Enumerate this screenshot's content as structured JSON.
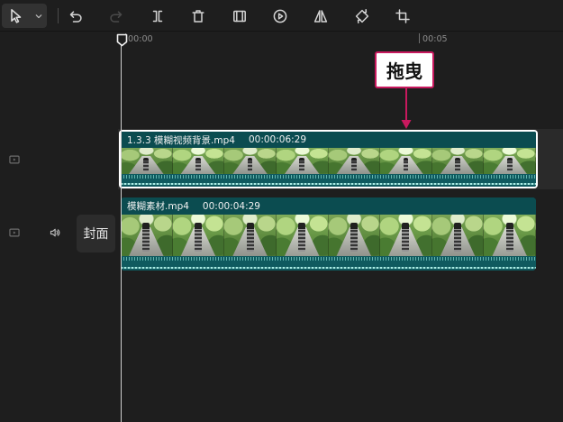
{
  "colors": {
    "background": "#1e1e1e",
    "clip": "#0f5a5f",
    "clip_header": "#0b4c50",
    "selection_border": "#ffffff",
    "annotation_accent": "#c8195e",
    "playhead": "#cfcfcf",
    "selected_track_row": "#2a2a2a"
  },
  "toolbar": {
    "select_tool": {
      "icon": "cursor-select-icon",
      "dropdown_icon": "chevron-down-icon",
      "active": true
    },
    "tools": [
      {
        "icon": "undo-icon",
        "enabled": true
      },
      {
        "icon": "redo-icon",
        "enabled": false
      },
      {
        "icon": "split-icon",
        "enabled": true
      },
      {
        "icon": "delete-icon",
        "enabled": true
      },
      {
        "icon": "freeze-frame-icon",
        "enabled": true
      },
      {
        "icon": "reverse-icon",
        "enabled": true
      },
      {
        "icon": "mirror-icon",
        "enabled": true
      },
      {
        "icon": "rotate-icon",
        "enabled": true
      },
      {
        "icon": "crop-icon",
        "enabled": true
      }
    ]
  },
  "ruler": {
    "timecodes": [
      "00:00",
      "00:05"
    ]
  },
  "annotation": {
    "label": "拖曳"
  },
  "tracks": {
    "overlay": {
      "header_icons": [
        "video-track-icon"
      ],
      "clip": {
        "name": "1.3.3 模糊视频背景.mp4",
        "duration": "00:00:06:29",
        "selected": true
      }
    },
    "main": {
      "header_icons": [
        "video-track-icon",
        "speaker-icon"
      ],
      "cover_button_label": "封面",
      "clip": {
        "name": "模糊素材.mp4",
        "duration": "00:00:04:29",
        "selected": false
      }
    }
  }
}
